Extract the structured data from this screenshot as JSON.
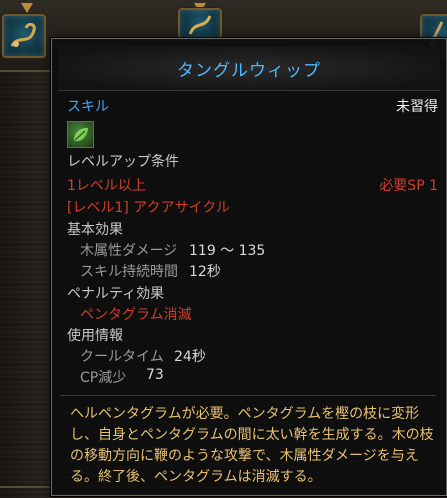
{
  "tooltip": {
    "title": "タングルウィップ",
    "category": "スキル",
    "status": "未習得",
    "levelup_heading": "レベルアップ条件",
    "level_requirement": "1レベル以上",
    "sp_requirement": "必要SP 1",
    "prereq_skill": "[レベル1] アクアサイクル",
    "basic_heading": "基本効果",
    "damage_label": "木属性ダメージ",
    "damage_value": "119 ～ 135",
    "duration_label": "スキル持続時間",
    "duration_value": "12秒",
    "penalty_heading": "ペナルティ効果",
    "penalty_value": "ペンタグラム消滅",
    "usage_heading": "使用情報",
    "cooldown_label": "クールタイム",
    "cooldown_value": "24秒",
    "cp_label": "CP減少",
    "cp_value": "73",
    "description": "ヘルペンタグラムが必要。ペンタグラムを樫の枝に変形し、自身とペンタグラムの間に太い幹を生成する。木の枝の移動方向に鞭のような攻撃で、木属性ダメージを与える。終了後、ペンタグラムは消滅する。"
  },
  "colors": {
    "title": "#4fb8ff",
    "category": "#3fa9f5",
    "requirement": "#d23c2c",
    "description": "#e8c170"
  },
  "icons": [
    "vine-skill-icon",
    "tangle-skill-icon",
    "staff-skill-icon"
  ]
}
